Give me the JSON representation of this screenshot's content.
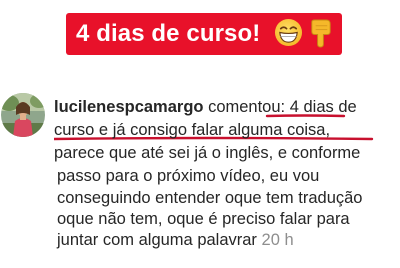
{
  "banner": {
    "text": "4 dias de curso!",
    "emojis": [
      "grinning-face-icon",
      "backhand-index-pointing-down-icon"
    ],
    "background_color": "#e8112a",
    "text_color": "#ffffff"
  },
  "comment": {
    "username": "lucilenespcamargo",
    "action": "comentou:",
    "lines": [
      "4 dias de",
      "curso e já consigo falar alguma coisa,",
      "parece que até sei já o inglês, e conforme",
      "passo para o próximo vídeo, eu vou",
      "conseguindo entender oque tem tradução",
      "oque não tem, oque é preciso falar para",
      "juntar com alguma palavrar"
    ],
    "timestamp": "20 h",
    "underline_color": "#c8102e"
  }
}
